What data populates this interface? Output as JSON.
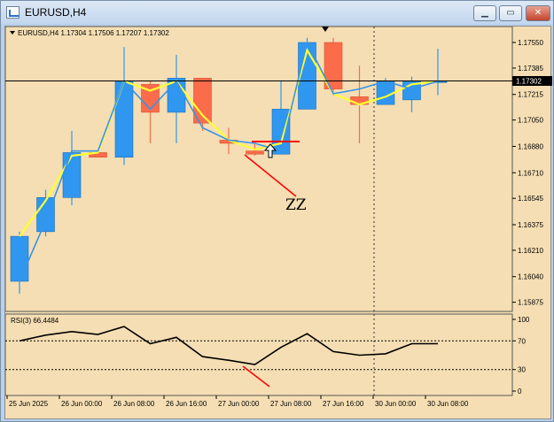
{
  "window": {
    "title": "EURUSD,H4",
    "min_icon": "minimize-icon",
    "max_icon": "maximize-icon",
    "close_icon": "close-icon"
  },
  "chart": {
    "info_line": "EURUSD,H4  1.17304 1.17506 1.17207 1.17302",
    "current_price_label": "1.17302",
    "annotation_text": "ZZ",
    "rsi_label": "RSI(3) 66.4484",
    "colors": {
      "background": "#f5deb3",
      "bull_candle": "#2f97f0",
      "bear_candle": "#fa6c4a",
      "ma_line": "#ffff33",
      "zigzag_line": "#3894e8",
      "annotation": "#ff0000"
    }
  },
  "chart_data": [
    {
      "type": "candlestick",
      "symbol": "EURUSD",
      "timeframe": "H4",
      "y_ticks": [
        "1.17550",
        "1.17385",
        "1.17215",
        "1.17050",
        "1.16880",
        "1.16710",
        "1.16545",
        "1.16375",
        "1.16210",
        "1.16040",
        "1.15875"
      ],
      "ylim": [
        1.1585,
        1.1763
      ],
      "x_ticks": [
        "25 Jun 2025",
        "26 Jun 00:00",
        "26 Jun 08:00",
        "26 Jun 16:00",
        "27 Jun 00:00",
        "27 Jun 08:00",
        "27 Jun 16:00",
        "30 Jun 00:00",
        "30 Jun 08:00"
      ],
      "candles": [
        {
          "o": 1.1601,
          "h": 1.1633,
          "l": 1.1593,
          "c": 1.163
        },
        {
          "o": 1.1633,
          "h": 1.166,
          "l": 1.163,
          "c": 1.1655
        },
        {
          "o": 1.1655,
          "h": 1.1698,
          "l": 1.165,
          "c": 1.1684
        },
        {
          "o": 1.1684,
          "h": 1.1684,
          "l": 1.1681,
          "c": 1.1681
        },
        {
          "o": 1.1681,
          "h": 1.1752,
          "l": 1.1676,
          "c": 1.173
        },
        {
          "o": 1.1728,
          "h": 1.173,
          "l": 1.169,
          "c": 1.171
        },
        {
          "o": 1.171,
          "h": 1.1747,
          "l": 1.169,
          "c": 1.1732
        },
        {
          "o": 1.1732,
          "h": 1.1732,
          "l": 1.1698,
          "c": 1.1703
        },
        {
          "o": 1.1692,
          "h": 1.17,
          "l": 1.1683,
          "c": 1.169
        },
        {
          "o": 1.1685,
          "h": 1.169,
          "l": 1.1682,
          "c": 1.1683
        },
        {
          "o": 1.1683,
          "h": 1.173,
          "l": 1.1683,
          "c": 1.1712
        },
        {
          "o": 1.1712,
          "h": 1.1758,
          "l": 1.1712,
          "c": 1.1755
        },
        {
          "o": 1.1755,
          "h": 1.1758,
          "l": 1.1721,
          "c": 1.1725
        },
        {
          "o": 1.172,
          "h": 1.174,
          "l": 1.169,
          "c": 1.1715
        },
        {
          "o": 1.1715,
          "h": 1.1732,
          "l": 1.1715,
          "c": 1.173
        },
        {
          "o": 1.1718,
          "h": 1.1733,
          "l": 1.171,
          "c": 1.173
        },
        {
          "o": 1.173,
          "h": 1.1751,
          "l": 1.1721,
          "c": 1.173
        }
      ],
      "ma_line": [
        1.163,
        1.1653,
        1.1682,
        1.1684,
        1.173,
        1.1724,
        1.173,
        1.1708,
        1.1692,
        1.1686,
        1.169,
        1.175,
        1.1722,
        1.1715,
        1.172,
        1.1728,
        1.173
      ],
      "zigzag_line": [
        1.1601,
        1.164,
        1.1685,
        1.1685,
        1.173,
        1.1712,
        1.173,
        1.17,
        1.1692,
        1.169,
        1.1685,
        1.1755,
        1.1722,
        1.1725,
        1.173,
        1.1725,
        1.173
      ],
      "current_price": 1.17302
    },
    {
      "type": "line",
      "name": "RSI(3)",
      "value": 66.4484,
      "y_ticks": [
        100,
        70,
        30,
        0
      ],
      "ylim": [
        0,
        100
      ],
      "levels": [
        70,
        30
      ],
      "values": [
        70,
        78,
        83,
        79,
        90,
        66,
        75,
        48,
        43,
        37,
        61,
        80,
        55,
        50,
        52,
        66,
        66
      ]
    }
  ]
}
